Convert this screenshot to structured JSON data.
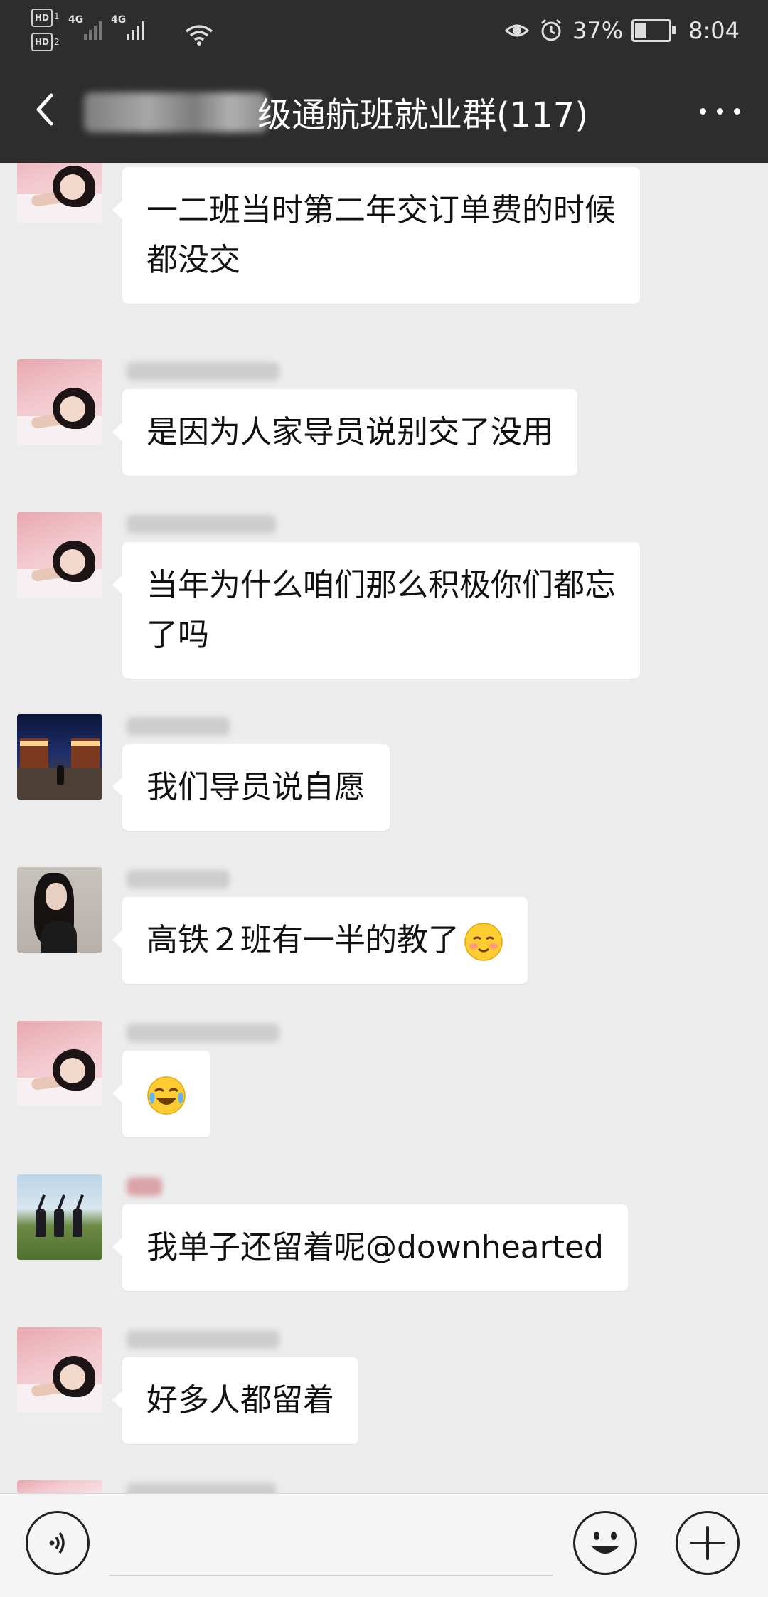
{
  "status_bar": {
    "hd1": "HD",
    "hd2": "HD",
    "sim1": "1",
    "sim2": "2",
    "net1": "4G",
    "net2": "4G",
    "battery_percent": "37%",
    "time": "8:04"
  },
  "header": {
    "title": "级通航班就业群(117)"
  },
  "messages": [
    {
      "avatar": "girl-pink-avatar",
      "text": "一二班当时第二年交订单费的时候\n都没交"
    },
    {
      "avatar": "girl-pink-avatar",
      "text": "是因为人家导员说别交了没用"
    },
    {
      "avatar": "girl-pink-avatar",
      "text": "当年为什么咱们那么积极你们都忘\n了吗"
    },
    {
      "avatar": "night-scene-avatar",
      "text": "我们导员说自愿"
    },
    {
      "avatar": "dark-hair-girl-avatar",
      "text": "高铁２班有一半的教了",
      "emoji": "smiling-blush-emoji"
    },
    {
      "avatar": "girl-pink-avatar",
      "text": "",
      "emoji": "crying-laughing-emoji"
    },
    {
      "avatar": "field-group-avatar",
      "text": "我单子还留着呢@downhearted"
    },
    {
      "avatar": "girl-pink-avatar",
      "text": "好多人都留着"
    }
  ],
  "input_bar": {
    "placeholder": "",
    "voice_icon": "voice-icon",
    "emoji_icon": "emoji-icon",
    "plus_icon": "plus-icon"
  }
}
